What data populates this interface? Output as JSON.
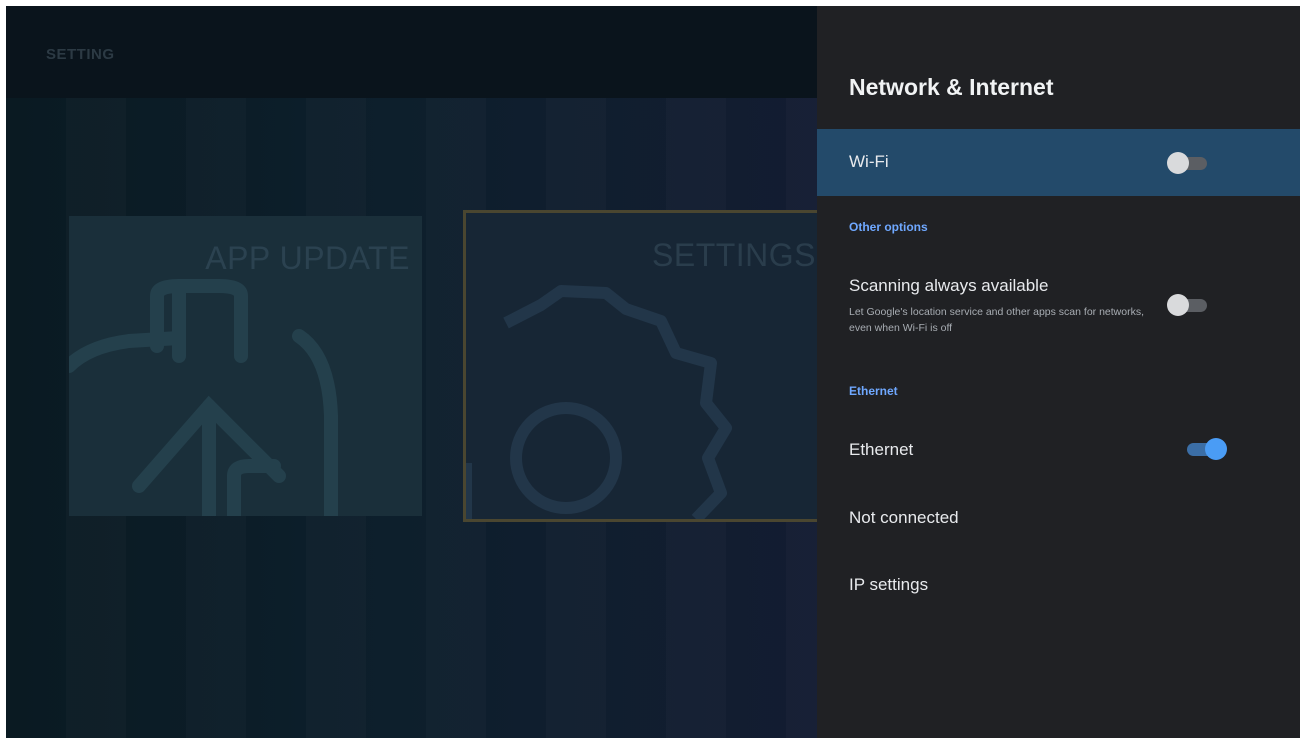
{
  "background": {
    "header_title": "SETTING",
    "tiles": [
      {
        "label": "APP UPDATE",
        "icon": "app-update-icon"
      },
      {
        "label": "SETTINGS",
        "icon": "gear-icon"
      }
    ]
  },
  "panel": {
    "title": "Network & Internet",
    "wifi": {
      "label": "Wi-Fi",
      "enabled": false
    },
    "other_options_header": "Other options",
    "scanning": {
      "title": "Scanning always available",
      "description": "Let Google's location service and other apps scan for networks, even when Wi-Fi is off",
      "enabled": false
    },
    "ethernet_header": "Ethernet",
    "ethernet": {
      "label": "Ethernet",
      "enabled": true
    },
    "status": "Not connected",
    "ip_settings": "IP settings"
  },
  "colors": {
    "panel_bg": "#202124",
    "selected_row": "#234a6a",
    "accent": "#6fa8ff",
    "toggle_on": "#4a9cf5"
  }
}
